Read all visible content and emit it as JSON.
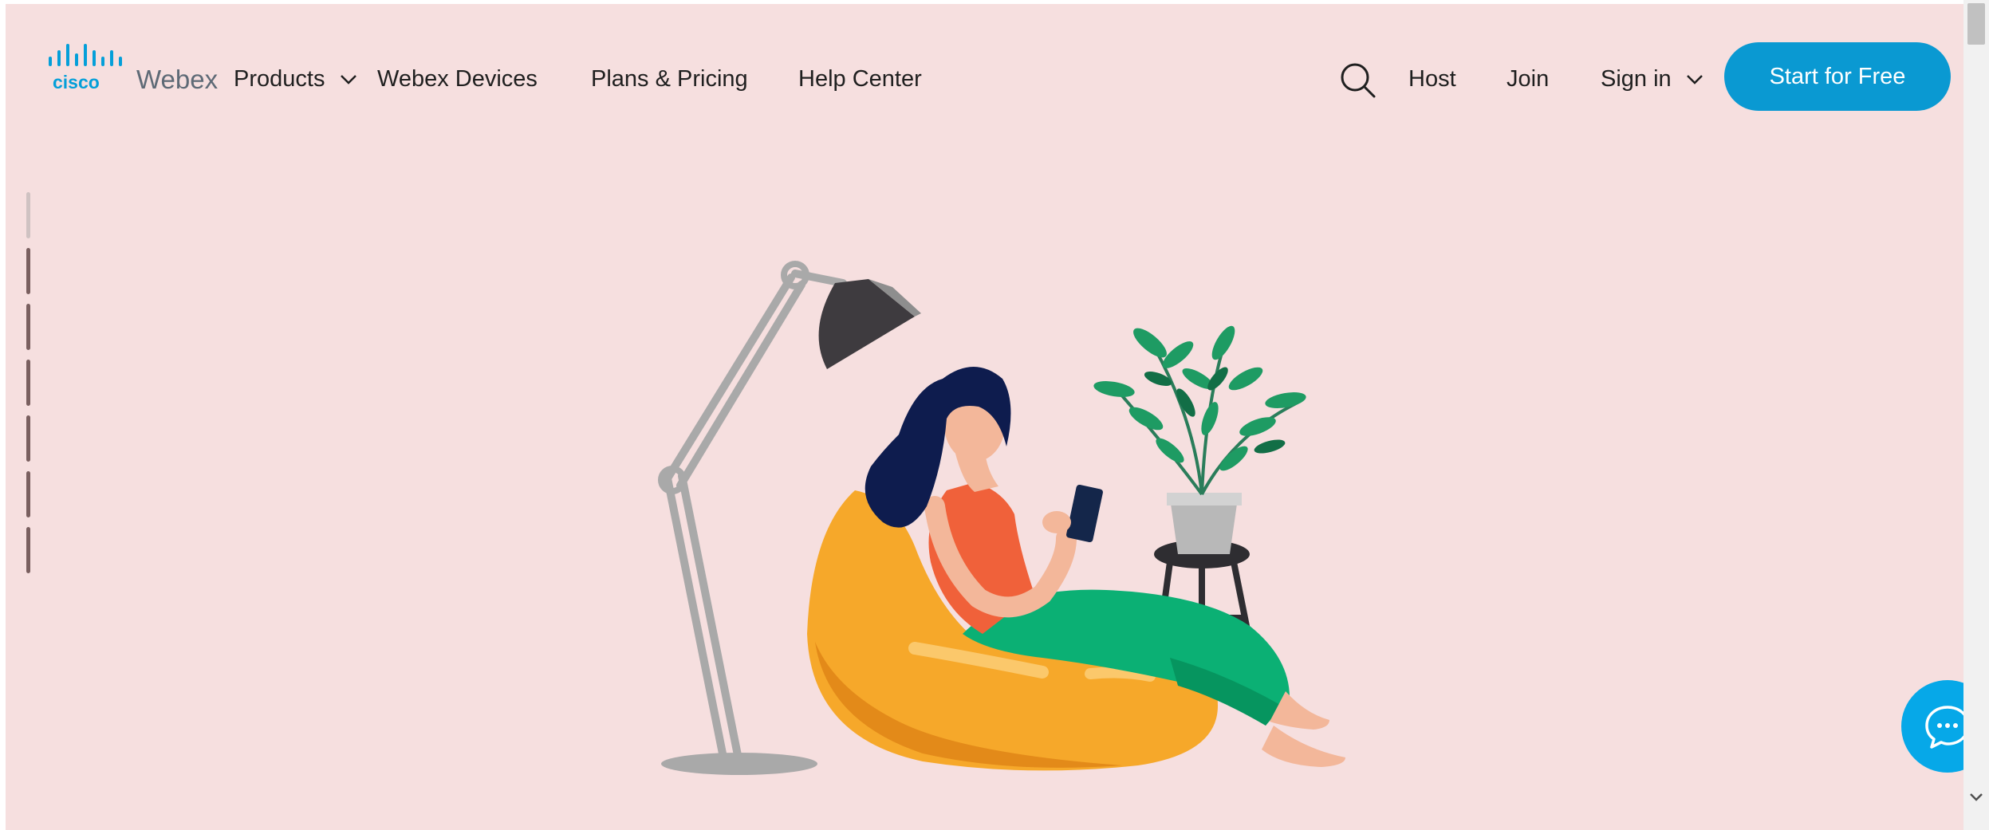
{
  "colors": {
    "page_background": "#f6dfdf",
    "cta_background": "#0a99d2",
    "chat_button": "#06a8e8",
    "progress_active": "#cfc2c2",
    "progress_inactive": "#7a5f5f",
    "text": "#1f1f1f"
  },
  "brand": {
    "company": "cisco",
    "product": "Webex"
  },
  "nav": {
    "products_label": "Products",
    "devices_label": "Webex Devices",
    "pricing_label": "Plans & Pricing",
    "help_label": "Help Center",
    "host_label": "Host",
    "join_label": "Join",
    "signin_label": "Sign in",
    "cta_label": "Start for Free"
  },
  "icons": {
    "search": "search-icon",
    "products_chevron": "chevron-down-icon",
    "signin_chevron": "chevron-down-icon",
    "chat": "chat-bubble-icon",
    "scroll_down": "chevron-down-icon"
  },
  "hero": {
    "illustration": "woman-on-beanbag-illustration",
    "slides_total": 7,
    "active_slide": 1
  }
}
